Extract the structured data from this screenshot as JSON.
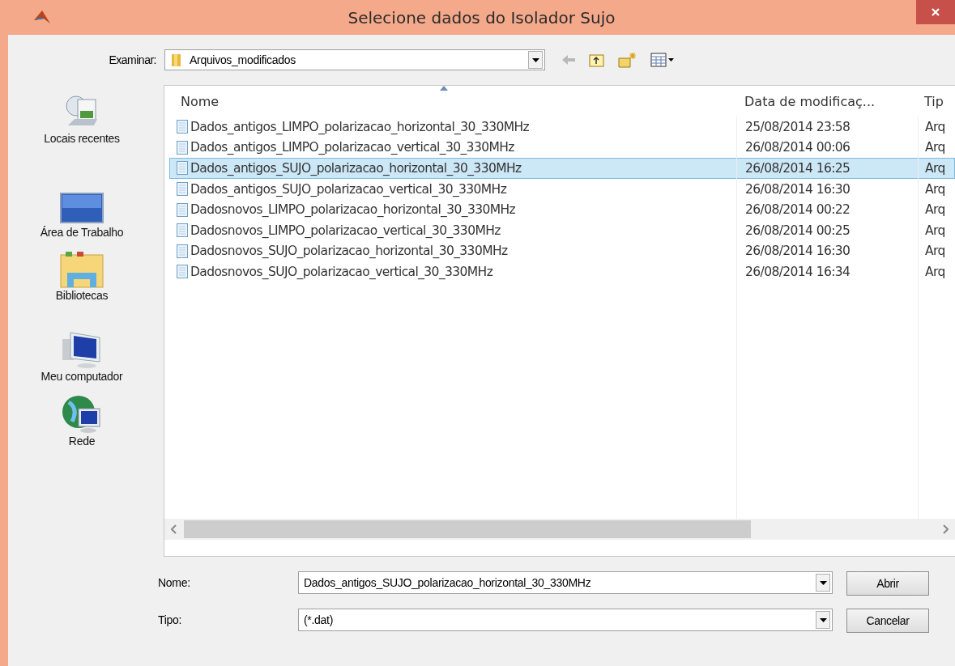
{
  "window": {
    "title": "Selecione dados do Isolador Sujo"
  },
  "toolbar": {
    "label": "Examinar:",
    "location": "Arquivos_modificados"
  },
  "places": [
    {
      "kind": "recent",
      "label": "Locais recentes"
    },
    {
      "kind": "desktop",
      "label": "Área de Trabalho"
    },
    {
      "kind": "libraries",
      "label": "Bibliotecas"
    },
    {
      "kind": "computer",
      "label": "Meu computador"
    },
    {
      "kind": "network",
      "label": "Rede"
    }
  ],
  "file_list": {
    "columns": [
      "Nome",
      "Data de modificaç...",
      "Tip"
    ],
    "rows": [
      {
        "name": "Dados_antigos_LIMPO_polarizacao_horizontal_30_330MHz",
        "date": "25/08/2014 23:58",
        "type": "Arq",
        "selected": false
      },
      {
        "name": "Dados_antigos_LIMPO_polarizacao_vertical_30_330MHz",
        "date": "26/08/2014 00:06",
        "type": "Arq",
        "selected": false
      },
      {
        "name": "Dados_antigos_SUJO_polarizacao_horizontal_30_330MHz",
        "date": "26/08/2014 16:25",
        "type": "Arq",
        "selected": true
      },
      {
        "name": "Dados_antigos_SUJO_polarizacao_vertical_30_330MHz",
        "date": "26/08/2014 16:30",
        "type": "Arq",
        "selected": false
      },
      {
        "name": "Dadosnovos_LIMPO_polarizacao_horizontal_30_330MHz",
        "date": "26/08/2014 00:22",
        "type": "Arq",
        "selected": false
      },
      {
        "name": "Dadosnovos_LIMPO_polarizacao_vertical_30_330MHz",
        "date": "26/08/2014 00:25",
        "type": "Arq",
        "selected": false
      },
      {
        "name": "Dadosnovos_SUJO_polarizacao_horizontal_30_330MHz",
        "date": "26/08/2014 16:30",
        "type": "Arq",
        "selected": false
      },
      {
        "name": "Dadosnovos_SUJO_polarizacao_vertical_30_330MHz",
        "date": "26/08/2014 16:34",
        "type": "Arq",
        "selected": false
      }
    ]
  },
  "form": {
    "fields": [
      {
        "label": "Nome:",
        "value": "Dados_antigos_SUJO_polarizacao_horizontal_30_330MHz"
      },
      {
        "label": "Tipo:",
        "value": "(*.dat)"
      }
    ],
    "buttons": [
      "Abrir",
      "Cancelar"
    ]
  }
}
